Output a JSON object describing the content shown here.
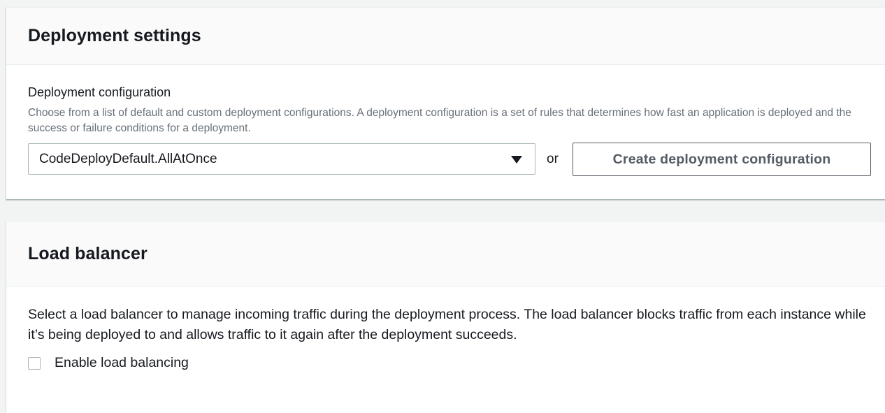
{
  "deployment_settings": {
    "title": "Deployment settings",
    "field_label": "Deployment configuration",
    "field_description": "Choose from a list of default and custom deployment configurations. A deployment configuration is a set of rules that determines how fast an application is deployed and the success or failure conditions for a deployment.",
    "selected_config": "CodeDeployDefault.AllAtOnce",
    "caret_icon": "caret-down-icon",
    "or_text": "or",
    "create_button_label": "Create deployment configuration"
  },
  "load_balancer": {
    "title": "Load balancer",
    "description": "Select a load balancer to manage incoming traffic during the deployment process. The load balancer blocks traffic from each instance while it’s being deployed to and allows traffic to it again after the deployment succeeds.",
    "enable_label": "Enable load balancing",
    "enable_checked": false
  },
  "colors": {
    "page_background": "#f2f3f3",
    "panel_background": "#ffffff",
    "header_background": "#fafafa",
    "text_primary": "#16191f",
    "text_secondary": "#687078",
    "button_border": "#545b64",
    "input_border": "#aab7b8"
  }
}
